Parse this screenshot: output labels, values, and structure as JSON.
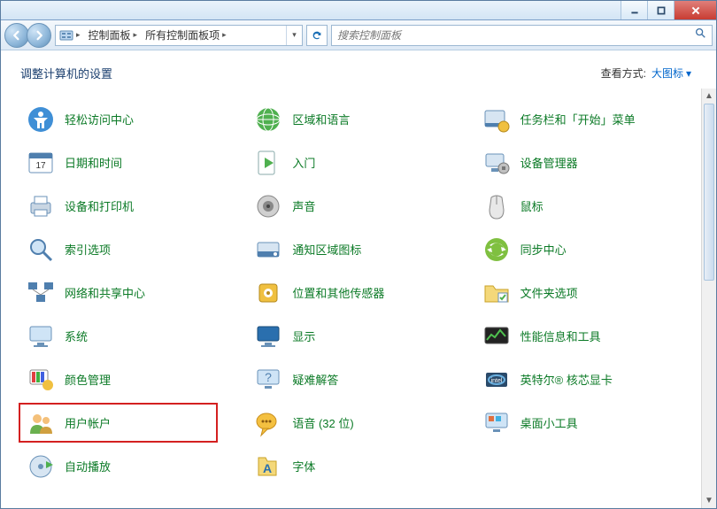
{
  "titlebar": {
    "tooltip_min": "最小化",
    "tooltip_max": "最大化",
    "tooltip_close": "关闭"
  },
  "breadcrumb": {
    "segments": [
      "控制面板",
      "所有控制面板项"
    ]
  },
  "search": {
    "placeholder": "搜索控制面板"
  },
  "header": {
    "title": "调整计算机的设置",
    "view_label": "查看方式:",
    "view_value": "大图标"
  },
  "items": [
    {
      "id": "ease-of-access",
      "label": "轻松访问中心"
    },
    {
      "id": "region-language",
      "label": "区域和语言"
    },
    {
      "id": "taskbar-start",
      "label": "任务栏和「开始」菜单"
    },
    {
      "id": "date-time",
      "label": "日期和时间"
    },
    {
      "id": "getting-started",
      "label": "入门"
    },
    {
      "id": "device-manager",
      "label": "设备管理器"
    },
    {
      "id": "devices-printers",
      "label": "设备和打印机"
    },
    {
      "id": "sound",
      "label": "声音"
    },
    {
      "id": "mouse",
      "label": "鼠标"
    },
    {
      "id": "indexing",
      "label": "索引选项"
    },
    {
      "id": "notification-area",
      "label": "通知区域图标"
    },
    {
      "id": "sync-center",
      "label": "同步中心"
    },
    {
      "id": "network-sharing",
      "label": "网络和共享中心"
    },
    {
      "id": "location-sensors",
      "label": "位置和其他传感器"
    },
    {
      "id": "folder-options",
      "label": "文件夹选项"
    },
    {
      "id": "system",
      "label": "系统"
    },
    {
      "id": "display",
      "label": "显示"
    },
    {
      "id": "performance-tools",
      "label": "性能信息和工具"
    },
    {
      "id": "color-management",
      "label": "颜色管理"
    },
    {
      "id": "troubleshoot",
      "label": "疑难解答"
    },
    {
      "id": "intel-graphics",
      "label": "英特尔® 核芯显卡"
    },
    {
      "id": "user-accounts",
      "label": "用户帐户",
      "highlight": true
    },
    {
      "id": "speech",
      "label": "语音 (32 位)"
    },
    {
      "id": "desktop-gadgets",
      "label": "桌面小工具"
    },
    {
      "id": "autoplay",
      "label": "自动播放"
    },
    {
      "id": "fonts",
      "label": "字体"
    }
  ],
  "icons": {
    "ease-of-access": "◉",
    "region-language": "🌐",
    "taskbar-start": "▭",
    "date-time": "📅",
    "getting-started": "▶",
    "device-manager": "🔧",
    "devices-printers": "🖨",
    "sound": "🔊",
    "mouse": "🖱",
    "indexing": "🔍",
    "notification-area": "▣",
    "sync-center": "🔄",
    "network-sharing": "▦",
    "location-sensors": "📍",
    "folder-options": "📁",
    "system": "💻",
    "display": "🖥",
    "performance-tools": "📊",
    "color-management": "🎨",
    "troubleshoot": "❓",
    "intel-graphics": "▪",
    "user-accounts": "👥",
    "speech": "💬",
    "desktop-gadgets": "🧩",
    "autoplay": "▶",
    "fonts": "A"
  }
}
